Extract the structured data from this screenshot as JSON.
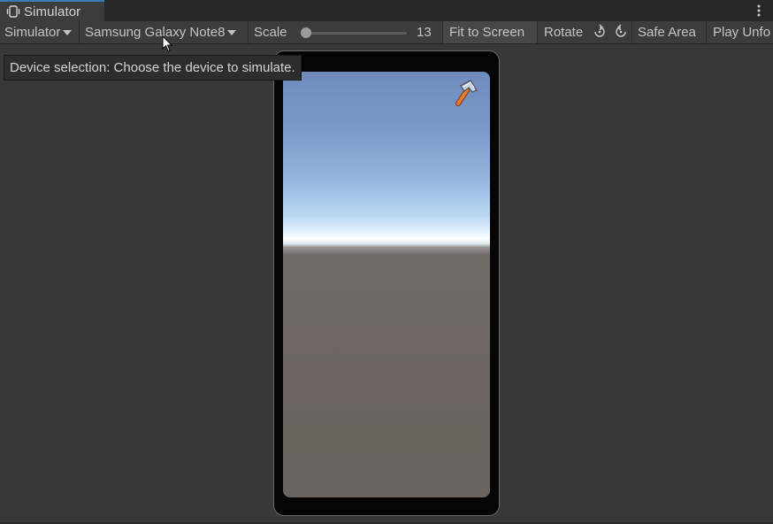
{
  "window": {
    "tab_title": "Simulator",
    "tab_icon": "simulator-device-icon",
    "menu_icon": "kebab-menu-icon"
  },
  "toolbar": {
    "mode_dropdown": "Simulator",
    "device_dropdown": "Samsung Galaxy Note8",
    "scale_label": "Scale",
    "scale_value": "13",
    "fit_to_screen": "Fit to Screen",
    "rotate_label": "Rotate",
    "rotate_left_icon": "rotate-left-icon",
    "rotate_right_icon": "rotate-right-icon",
    "safe_area": "Safe Area",
    "play_mode": "Play Unfo"
  },
  "tooltip": {
    "text": "Device selection: Choose the device to simulate."
  },
  "device": {
    "overlay_icon": "hammer-icon"
  },
  "colors": {
    "panel_bg": "#383838",
    "toolbar_bg": "#3c3c3c",
    "tab_accent": "#3a79bb",
    "sky_top": "#6f8bbb",
    "horizon": "#ffffff",
    "ground": "#6c6561"
  }
}
